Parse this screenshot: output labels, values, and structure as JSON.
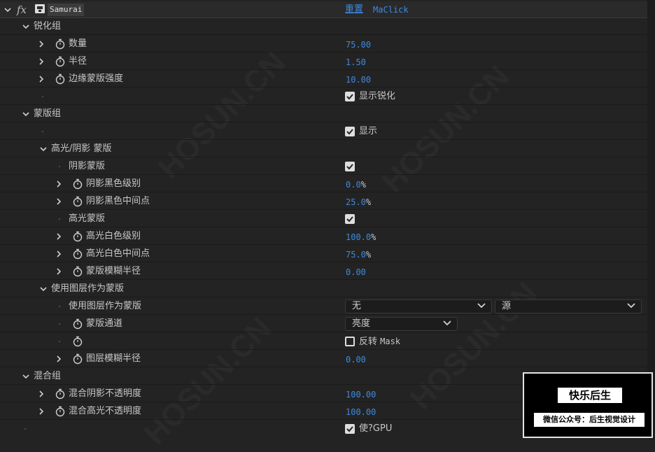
{
  "effect": {
    "name": "Samurai",
    "reset": "重置",
    "plugin": "MaClick"
  },
  "groups": {
    "sharpen": "锐化组",
    "matte": "蒙版组",
    "hl_shadow": "高光/阴影 蒙版",
    "use_layer": "使用图层作为蒙版",
    "blend": "混合组"
  },
  "params": {
    "amount": {
      "label": "数量",
      "value": "75.00"
    },
    "radius": {
      "label": "半径",
      "value": "1.50"
    },
    "edge_mask": {
      "label": "边缘蒙版强度",
      "value": "10.00"
    },
    "show_sharpen": {
      "label": "显示锐化",
      "checked": true
    },
    "show": {
      "label": "显示",
      "checked": true
    },
    "shadow_matte": {
      "label": "阴影蒙版",
      "checked": true
    },
    "shadow_black": {
      "label": "阴影黑色级别",
      "value": "0.0",
      "unit": "%"
    },
    "shadow_mid": {
      "label": "阴影黑色中间点",
      "value": "25.0",
      "unit": "%"
    },
    "highlight_matte": {
      "label": "高光蒙版",
      "checked": true
    },
    "hl_white": {
      "label": "高光白色级别",
      "value": "100.0",
      "unit": "%"
    },
    "hl_mid": {
      "label": "高光白色中间点",
      "value": "75.0",
      "unit": "%"
    },
    "matte_blur": {
      "label": "蒙版模糊半径",
      "value": "0.00"
    },
    "use_layer_param": {
      "label": "使用图层作为蒙版",
      "layer": "无",
      "source": "源"
    },
    "matte_channel": {
      "label": "蒙版通道",
      "value": "亮度"
    },
    "invert": {
      "label_cn": "反转",
      "label_en": "Mask",
      "checked": false
    },
    "layer_blur": {
      "label": "图层模糊半径",
      "value": "0.00"
    },
    "blend_shadow": {
      "label": "混合阴影不透明度",
      "value": "100.00"
    },
    "blend_highlight": {
      "label": "混合高光不透明度",
      "value": "100.00"
    },
    "use_gpu": {
      "label": "使?GPU",
      "checked": true
    }
  },
  "watermark": {
    "title": "快乐后生",
    "subtitle": "微信公众号：后生视觉设计"
  },
  "colors": {
    "bg": "#232323",
    "value_blue": "#3d8ae0",
    "text": "#c8c8c8"
  },
  "icons": [
    "chevron-down-icon",
    "chevron-right-icon",
    "fx-icon",
    "effect-icon",
    "stopwatch-icon",
    "checkbox-icon",
    "dropdown-arrow-icon"
  ]
}
